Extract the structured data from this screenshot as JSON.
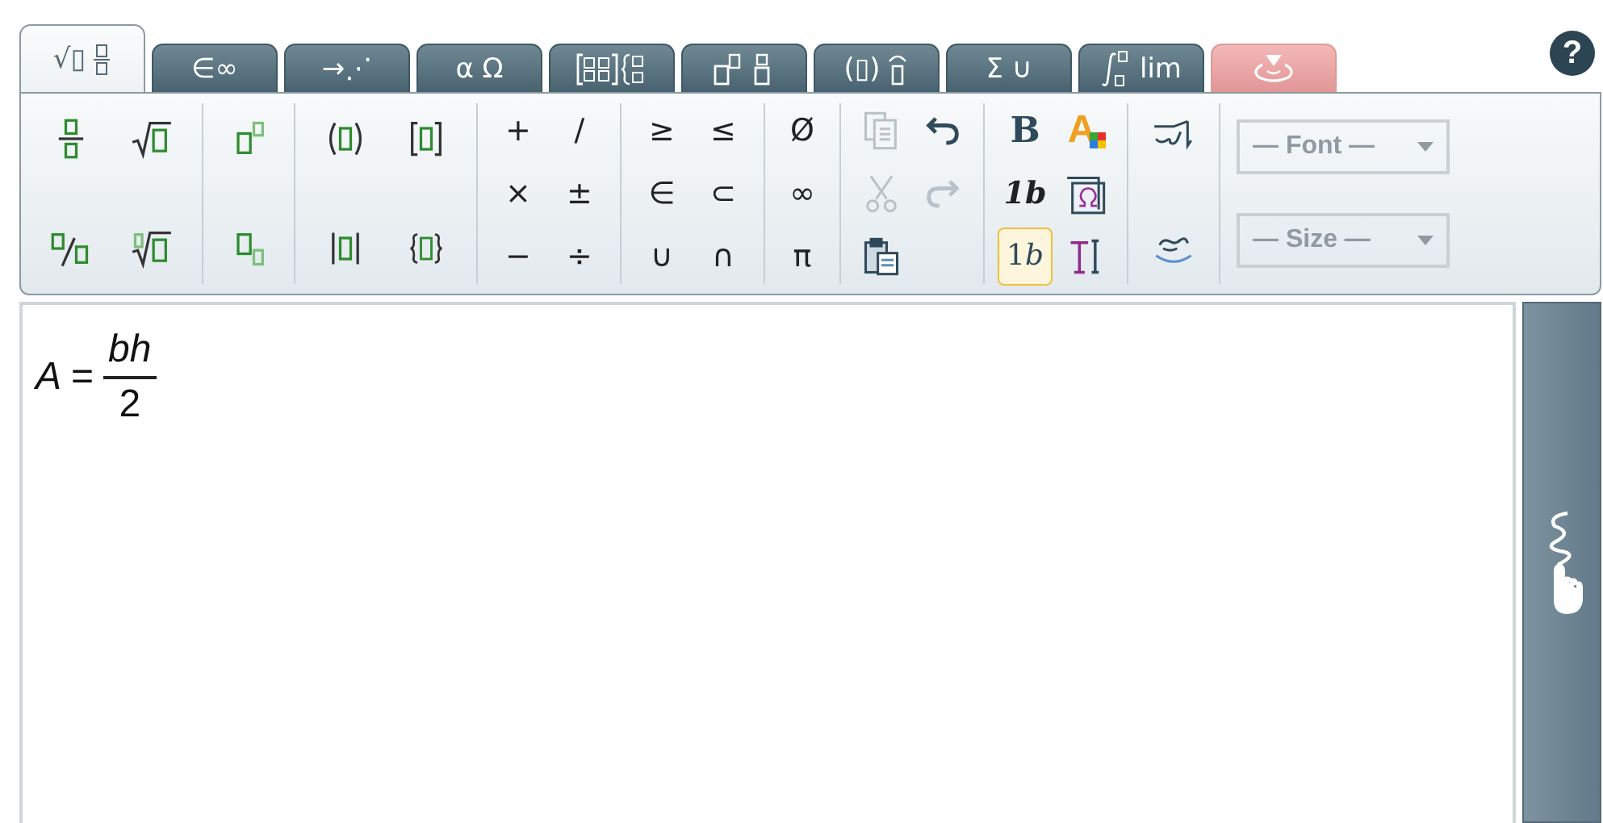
{
  "tabs": [
    {
      "kind": "roots",
      "label": "√▯",
      "selected": true
    },
    {
      "kind": "plain",
      "label": "∈∞",
      "selected": false
    },
    {
      "kind": "plain",
      "label": "→⋰",
      "selected": false
    },
    {
      "kind": "plain",
      "label": "α Ω",
      "selected": false
    },
    {
      "kind": "matrix",
      "selected": false
    },
    {
      "kind": "scripts",
      "selected": false
    },
    {
      "kind": "accents",
      "label": "(▯)",
      "selected": false
    },
    {
      "kind": "plain",
      "label": "Σ ∪",
      "selected": false
    },
    {
      "kind": "calculus",
      "label": "lim",
      "selected": false
    },
    {
      "kind": "drop",
      "selected": false
    }
  ],
  "help": "?",
  "groups": [
    {
      "kind": "two-rows",
      "buttons": [
        {
          "kind": "fraction"
        },
        {
          "kind": "root"
        },
        {
          "kind": "slash-fraction"
        },
        {
          "kind": "nth-root"
        }
      ]
    },
    {
      "kind": "one-col",
      "buttons": [
        {
          "kind": "superscript"
        },
        {
          "kind": "subscript"
        }
      ]
    },
    {
      "kind": "two-rows",
      "buttons": [
        {
          "kind": "parentheses"
        },
        {
          "kind": "brackets"
        },
        {
          "kind": "absolute"
        },
        {
          "kind": "braces"
        }
      ]
    },
    {
      "kind": "three-rows",
      "buttons": [
        {
          "kind": "symbol",
          "label": "+"
        },
        {
          "kind": "symbol",
          "label": "/"
        },
        {
          "kind": "symbol",
          "label": "×"
        },
        {
          "kind": "symbol",
          "label": "±"
        },
        {
          "kind": "symbol",
          "label": "−"
        },
        {
          "kind": "symbol",
          "label": "÷"
        }
      ]
    },
    {
      "kind": "three-rows",
      "buttons": [
        {
          "kind": "symbol",
          "label": "≥"
        },
        {
          "kind": "symbol",
          "label": "≤"
        },
        {
          "kind": "symbol",
          "label": "∈"
        },
        {
          "kind": "symbol",
          "label": "⊂"
        },
        {
          "kind": "symbol",
          "label": "∪"
        },
        {
          "kind": "symbol",
          "label": "∩"
        }
      ]
    },
    {
      "kind": "three-single",
      "buttons": [
        {
          "kind": "symbol",
          "label": "Ø"
        },
        {
          "kind": "symbol",
          "label": "∞"
        },
        {
          "kind": "symbol",
          "label": "π"
        }
      ]
    },
    {
      "kind": "three-rows",
      "buttons": [
        {
          "kind": "copy",
          "disabled": true
        },
        {
          "kind": "undo",
          "disabled": false
        },
        {
          "kind": "cut",
          "disabled": true
        },
        {
          "kind": "redo",
          "disabled": true
        },
        {
          "kind": "paste",
          "disabled": false
        }
      ]
    },
    {
      "kind": "three-rows",
      "buttons": [
        {
          "kind": "bold",
          "label": "B",
          "selected": false
        },
        {
          "kind": "color",
          "label": "A",
          "selected": false
        },
        {
          "kind": "italic",
          "label": "1b",
          "selected": false
        },
        {
          "kind": "symbol-style",
          "selected": false
        },
        {
          "kind": "normal",
          "label": "1",
          "italic_part": "b",
          "selected": true
        },
        {
          "kind": "text",
          "selected": false
        }
      ]
    },
    {
      "kind": "one-col",
      "buttons": [
        {
          "kind": "rtl"
        },
        {
          "kind": "rtl-below"
        }
      ]
    }
  ],
  "dropdowns": [
    {
      "value": "— Font —",
      "disabled": true
    },
    {
      "value": "— Size —",
      "disabled": true
    }
  ],
  "formula": {
    "lhs": "A",
    "relation": "=",
    "numerator": "bh",
    "denominator": "2"
  }
}
